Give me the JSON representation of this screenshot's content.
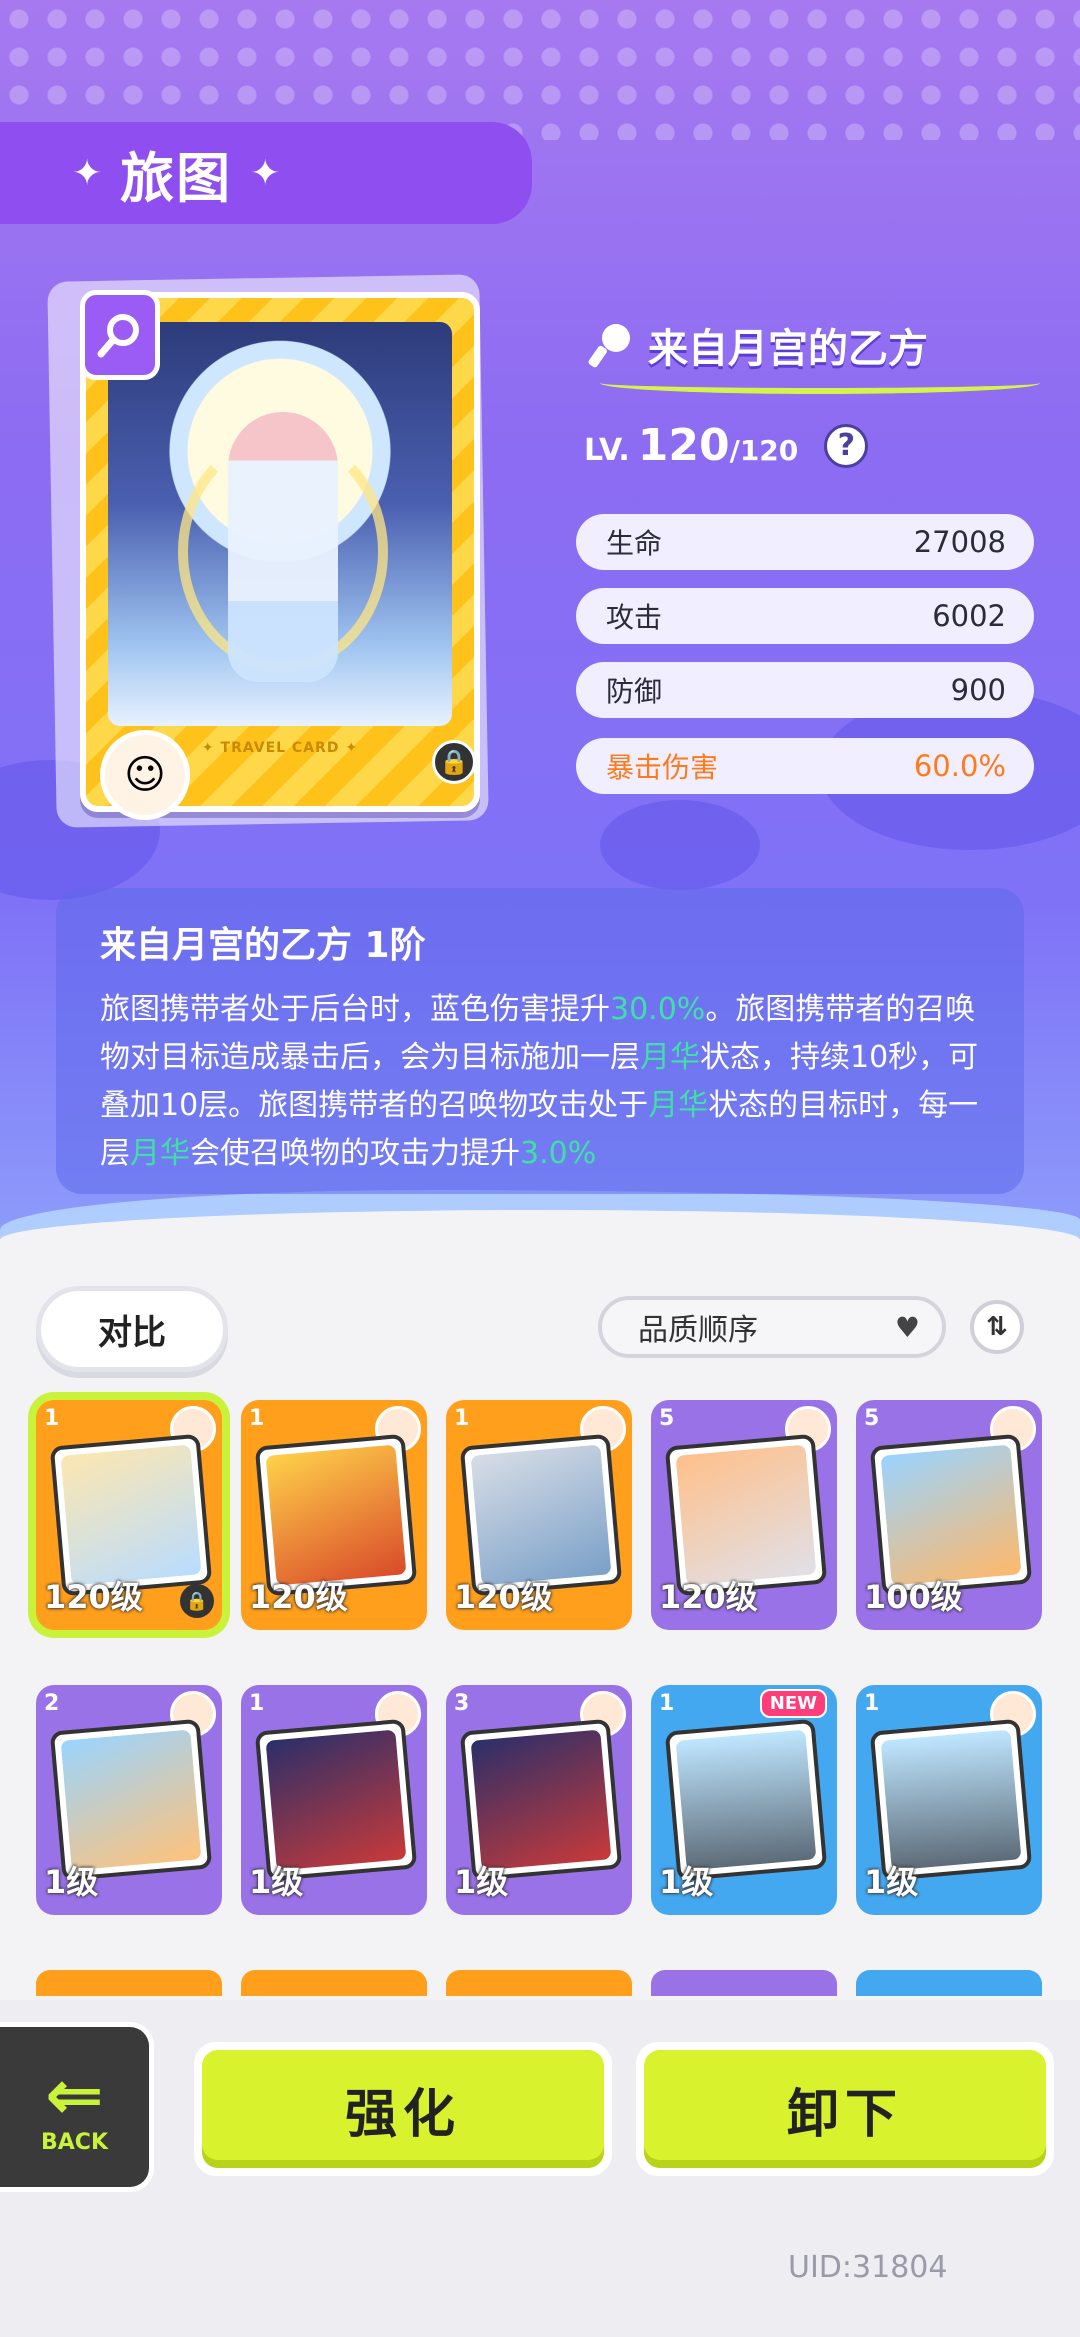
{
  "header": {
    "title": "旅图",
    "left_star": "✦",
    "right_star": "✦"
  },
  "card": {
    "footer_text": "✦ TRAVEL CARD ✦",
    "name": "来自月宫的乙方",
    "level_label": "LV.",
    "level": "120",
    "level_max": "/120",
    "help": "?"
  },
  "stats": [
    {
      "label": "生命",
      "value": "27008"
    },
    {
      "label": "攻击",
      "value": "6002"
    },
    {
      "label": "防御",
      "value": "900"
    },
    {
      "label": "暴击伤害",
      "value": "60.0%"
    }
  ],
  "description": {
    "title": "来自月宫的乙方 1阶",
    "p1": "旅图携带者处于后台时，蓝色伤害提升",
    "v1": "30.0%",
    "p2": "。旅图携带者的召唤物对目标造成暴击后，会为目标施加一层",
    "v2": "月华",
    "p3": "状态，持续10秒，可叠加10层。旅图携带者的召唤物攻击处于",
    "v3": "月华",
    "p4": "状态的目标时，每一层",
    "v4": "月华",
    "p5": "会使召唤物的攻击力提升",
    "v5": "3.0%"
  },
  "toolbar": {
    "compare_label": "对比",
    "sort_label": "品质顺序",
    "sort_chevron": "♥",
    "sort_order_icon": "⇅"
  },
  "grid": {
    "cards": [
      {
        "rank": "1",
        "level": "120级",
        "color": "orange",
        "selected": true,
        "locked": true
      },
      {
        "rank": "1",
        "level": "120级",
        "color": "orange"
      },
      {
        "rank": "1",
        "level": "120级",
        "color": "orange"
      },
      {
        "rank": "5",
        "level": "120级",
        "color": "purple"
      },
      {
        "rank": "5",
        "level": "100级",
        "color": "purple"
      },
      {
        "rank": "2",
        "level": "1级",
        "color": "purple"
      },
      {
        "rank": "1",
        "level": "1级",
        "color": "purple"
      },
      {
        "rank": "3",
        "level": "1级",
        "color": "purple"
      },
      {
        "rank": "1",
        "level": "1级",
        "color": "blue",
        "new": true,
        "new_label": "NEW"
      },
      {
        "rank": "1",
        "level": "1级",
        "color": "blue"
      }
    ]
  },
  "actions": {
    "back_label": "BACK",
    "enhance_label": "强化",
    "unequip_label": "卸下"
  },
  "uid": "UID:31804"
}
